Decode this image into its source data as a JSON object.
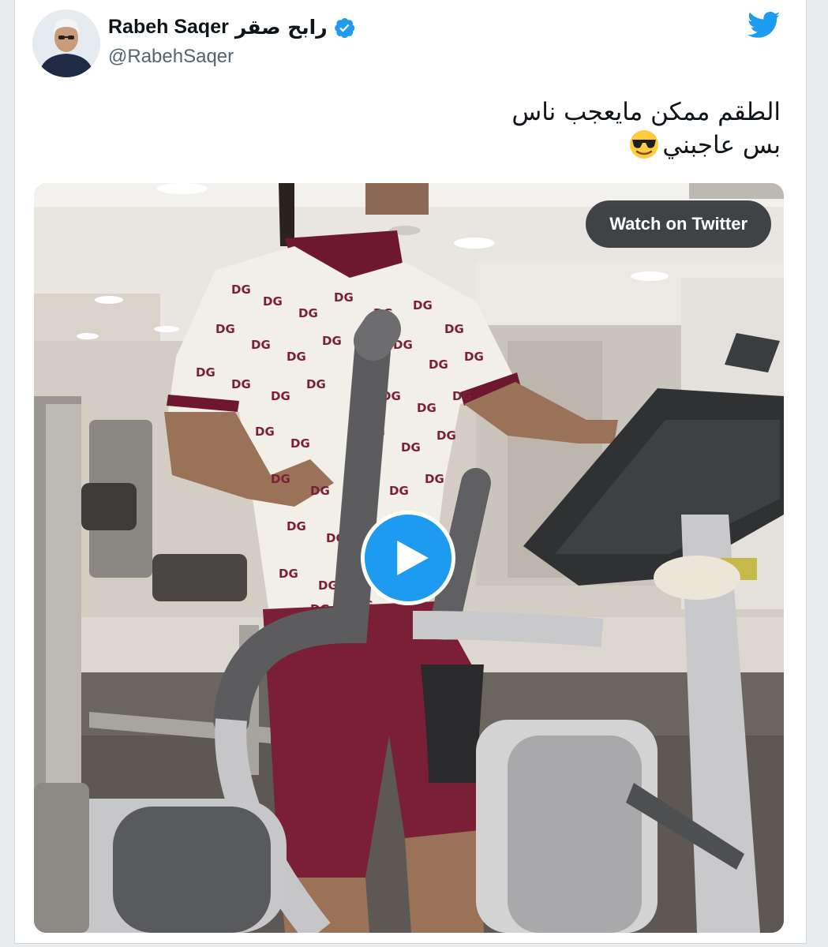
{
  "tweet": {
    "display_name": "Rabeh Saqer",
    "display_name_ar": "رابح صقر",
    "handle": "@RabehSaqer",
    "verified": true,
    "text_lines": [
      "الطقم ممكن مايعجب ناس",
      "بس عاجبني"
    ],
    "text_emoji": "😎"
  },
  "media": {
    "watch_label": "Watch on Twitter",
    "play_icon": "play-icon",
    "shirt_monogram": "DG"
  },
  "icons": {
    "brand": "twitter-bird-icon",
    "verified": "verified-badge-icon"
  },
  "colors": {
    "accent": "#1d9bf0",
    "text": "#0f1419",
    "secondary_text": "#536471",
    "shorts": "#7a1f35"
  }
}
